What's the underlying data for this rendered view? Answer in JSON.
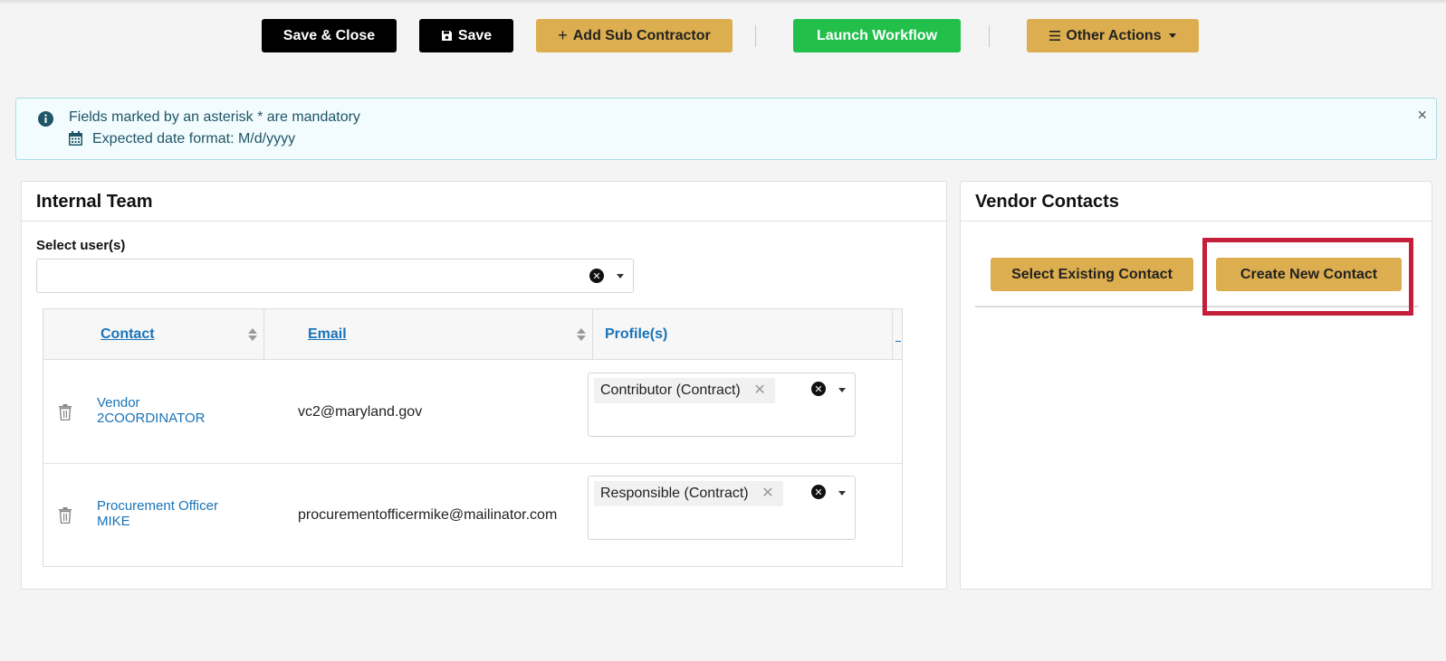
{
  "toolbar": {
    "save_close": "Save & Close",
    "save": "Save",
    "add_sub": "Add Sub Contractor",
    "launch": "Launch Workflow",
    "other": "Other Actions"
  },
  "alert": {
    "line1": "Fields marked by an asterisk * are mandatory",
    "line2": "Expected date format: M/d/yyyy",
    "close": "×"
  },
  "internal_team": {
    "title": "Internal Team",
    "select_label": "Select user(s)",
    "columns": {
      "contact": "Contact",
      "email": "Email",
      "profiles": "Profile(s)"
    },
    "rows": [
      {
        "contact_line1": "Vendor",
        "contact_line2": "2COORDINATOR",
        "email": "vc2@maryland.gov",
        "profile": "Contributor (Contract)"
      },
      {
        "contact_line1": "Procurement Officer",
        "contact_line2": "MIKE",
        "email": "procurementofficermike@mailinator.com",
        "profile": "Responsible (Contract)"
      }
    ]
  },
  "vendor_contacts": {
    "title": "Vendor Contacts",
    "select_existing": "Select Existing Contact",
    "create_new": "Create New Contact"
  },
  "colors": {
    "accent_gold": "#dcae4f",
    "accent_green": "#22bf4b",
    "link_blue": "#1a73b8",
    "highlight_red": "#c41e3a"
  }
}
